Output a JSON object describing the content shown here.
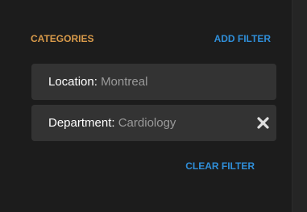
{
  "categories": {
    "title": "CATEGORIES",
    "add_filter_label": "ADD FILTER",
    "clear_filter_label": "CLEAR FILTER",
    "filters": [
      {
        "key": "Location",
        "separator": ":",
        "value": "Montreal",
        "removable": false
      },
      {
        "key": "Department",
        "separator": ":",
        "value": "Cardiology",
        "removable": true
      }
    ],
    "remove_icon": "close-icon"
  },
  "colors": {
    "background": "#1c1c1c",
    "header_accent": "#d89a4a",
    "link": "#2f8ed8",
    "row_background": "#333333",
    "value_text": "#9a9a9a"
  }
}
